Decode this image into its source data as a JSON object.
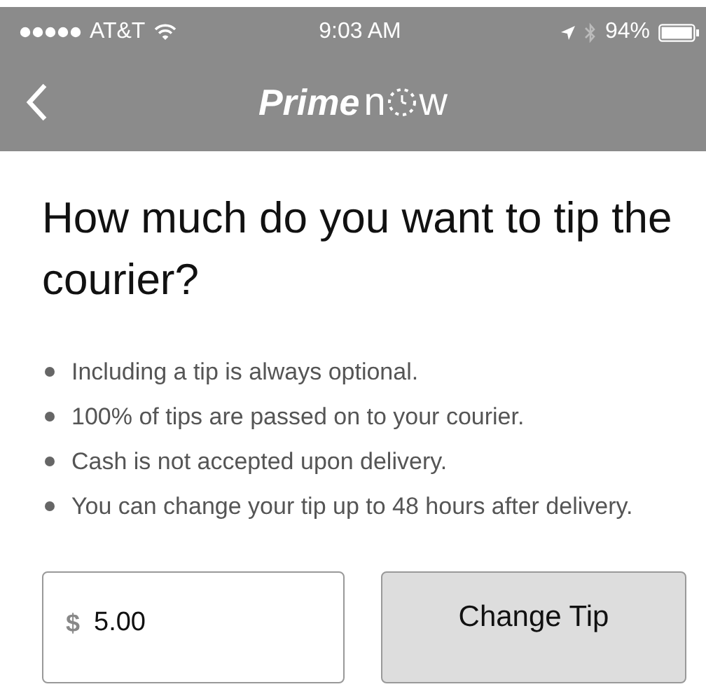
{
  "status_bar": {
    "carrier": "AT&T",
    "time": "9:03 AM",
    "battery": "94%"
  },
  "nav": {
    "logo": {
      "bold": "Prime",
      "light_start": "n",
      "light_end": "w"
    }
  },
  "heading": "How much do you want to tip the courier?",
  "notes": [
    "Including a tip is always optional.",
    "100% of tips are passed on to your courier.",
    "Cash is not accepted upon delivery.",
    "You can change your tip up to 48 hours after delivery."
  ],
  "tip": {
    "currency": "$",
    "value": "5.00",
    "button": "Change Tip"
  }
}
